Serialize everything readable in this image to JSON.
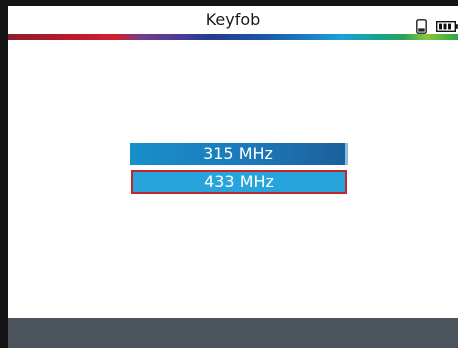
{
  "header": {
    "title": "Keyfob",
    "icons": [
      "sd-card-icon",
      "battery-icon"
    ]
  },
  "frequency_list": {
    "items": [
      {
        "label": "315 MHz",
        "selected": false
      },
      {
        "label": "433 MHz",
        "selected": true
      }
    ]
  },
  "colors": {
    "item_blue": "#1c79b9",
    "selected_fill": "#27a4dc",
    "selected_border": "#c0262c",
    "footer": "#4b545c",
    "frame": "#141414"
  }
}
